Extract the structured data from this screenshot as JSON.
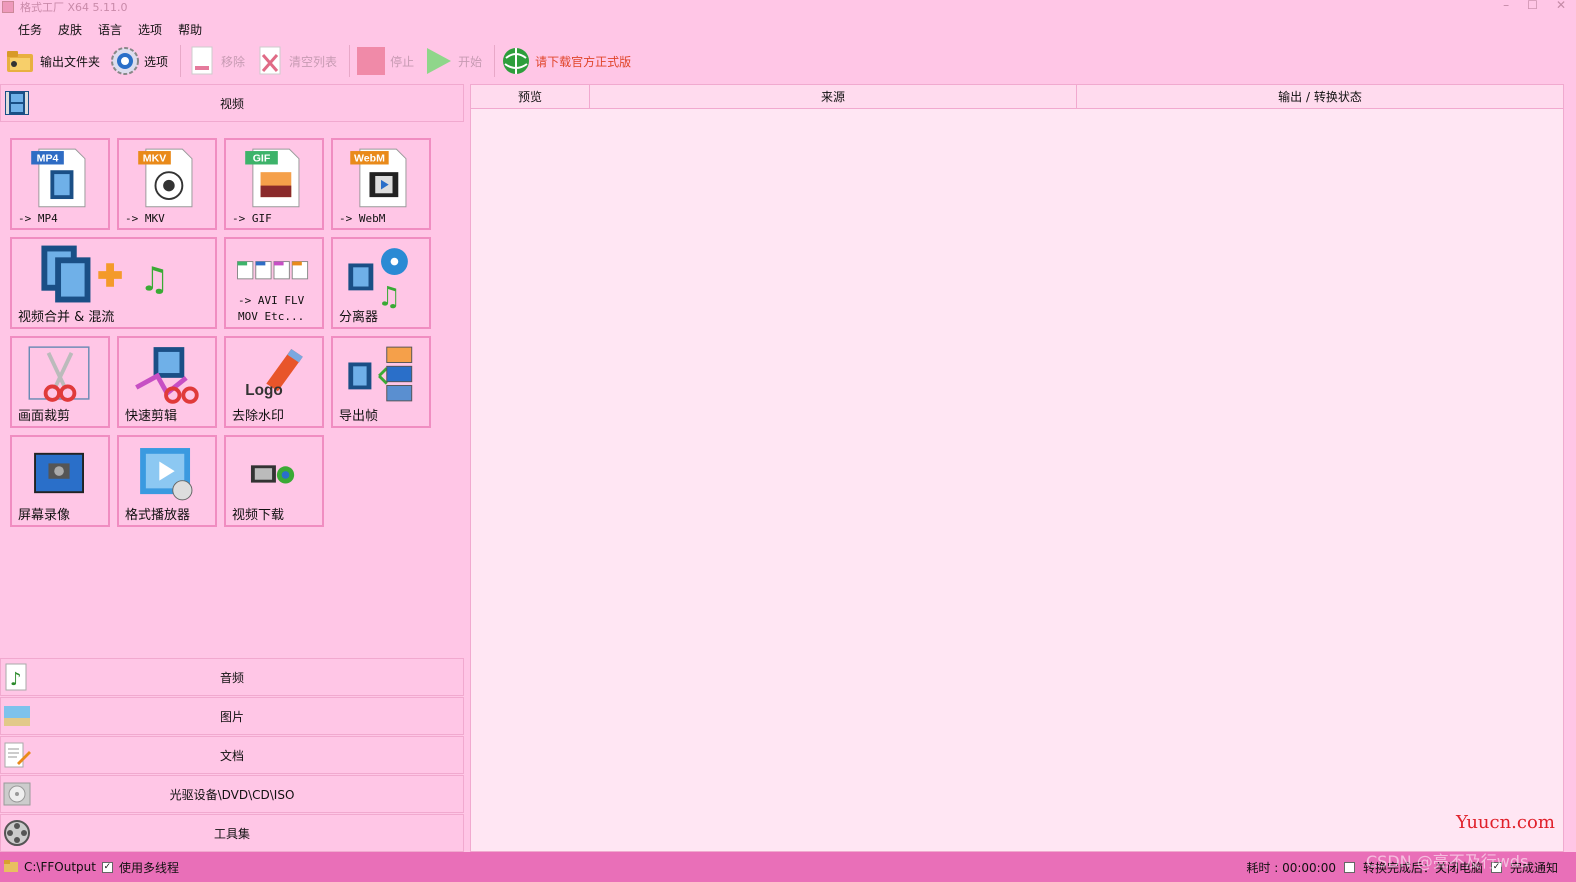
{
  "window": {
    "title": "格式工厂 X64 5.11.0"
  },
  "menu": [
    "任务",
    "皮肤",
    "语言",
    "选项",
    "帮助"
  ],
  "toolbar": {
    "output_folder": "输出文件夹",
    "options": "选项",
    "remove": "移除",
    "clear_list": "清空列表",
    "stop": "停止",
    "start": "开始",
    "download_official": "请下载官方正式版"
  },
  "categories": {
    "video": "视频",
    "audio": "音频",
    "image": "图片",
    "document": "文档",
    "disc": "光驱设备\\DVD\\CD\\ISO",
    "tools": "工具集"
  },
  "video_tiles": {
    "mp4": {
      "badge": "MP4",
      "label": "-> MP4"
    },
    "mkv": {
      "badge": "MKV",
      "label": "-> MKV"
    },
    "gif": {
      "badge": "GIF",
      "label": "-> GIF"
    },
    "webm": {
      "badge": "WebM",
      "label": "-> WebM"
    },
    "merge": "视频合并 & 混流",
    "other_formats": "-> AVI FLV\nMOV Etc...",
    "splitter": "分离器",
    "crop": "画面裁剪",
    "quick_edit": "快速剪辑",
    "remove_watermark": "去除水印",
    "logo_text": "Logo",
    "export_frames": "导出帧",
    "screen_record": "屏幕录像",
    "player": "格式播放器",
    "video_download": "视频下载"
  },
  "table": {
    "columns": [
      "预览",
      "来源",
      "输出 / 转换状态"
    ]
  },
  "status": {
    "output_path": "C:\\FFOutput",
    "multithread_label": "使用多线程",
    "multithread_checked": true,
    "elapsed": "耗时 : 00:00:00",
    "after_convert_label": "转换完成后：关闭电脑",
    "after_convert_checked": false,
    "notify_label": "完成通知",
    "notify_checked": true
  },
  "watermark": "Yuucn.com",
  "csdn_mark": "CSDN @亮不及行wds"
}
